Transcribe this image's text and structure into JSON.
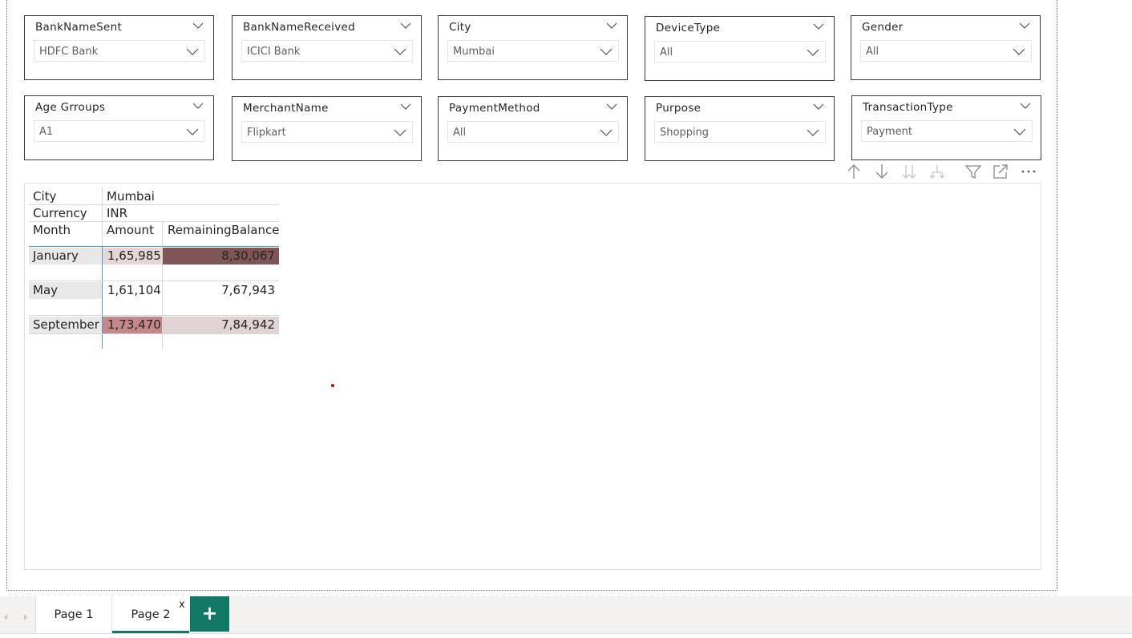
{
  "slicers": [
    {
      "title": "BankNameSent",
      "value": "HDFC Bank"
    },
    {
      "title": "BankNameReceived",
      "value": "ICICI Bank"
    },
    {
      "title": "City",
      "value": "Mumbai"
    },
    {
      "title": "DeviceType",
      "value": "All"
    },
    {
      "title": "Gender",
      "value": "All"
    },
    {
      "title": "Age Grroups",
      "value": "A1"
    },
    {
      "title": "MerchantName",
      "value": "Flipkart"
    },
    {
      "title": "PaymentMethod",
      "value": "All"
    },
    {
      "title": "Purpose",
      "value": "Shopping"
    },
    {
      "title": "TransactionType",
      "value": "Payment"
    }
  ],
  "matrix": {
    "header_rows": [
      {
        "label": "City",
        "value": "Mumbai"
      },
      {
        "label": "Currency",
        "value": "INR"
      }
    ],
    "columns": [
      "Month",
      "Amount",
      "RemainingBalance"
    ],
    "rows": [
      {
        "month": "January",
        "amount": "1,65,985",
        "balance": "8,30,067"
      },
      {
        "month": "May",
        "amount": "1,61,104",
        "balance": "7,67,943"
      },
      {
        "month": "September",
        "amount": "1,73,470",
        "balance": "7,84,942"
      }
    ],
    "colors": {
      "january_balance": "#7f5558",
      "january_amount": "#e4d7d8",
      "september_amount": "#c4888a",
      "september_balance": "#e1d3d4",
      "row_label_bg": "#e8e8e8"
    }
  },
  "toolbar": {
    "icons": [
      "drill-up-icon",
      "drill-down-icon",
      "expand-all-icon",
      "expand-next-level-icon",
      "filter-icon",
      "focus-mode-icon",
      "more-options-icon"
    ]
  },
  "tabs": {
    "items": [
      "Page 1",
      "Page 2"
    ],
    "close_label": "x",
    "add_label": "+",
    "accent": "#117865"
  }
}
